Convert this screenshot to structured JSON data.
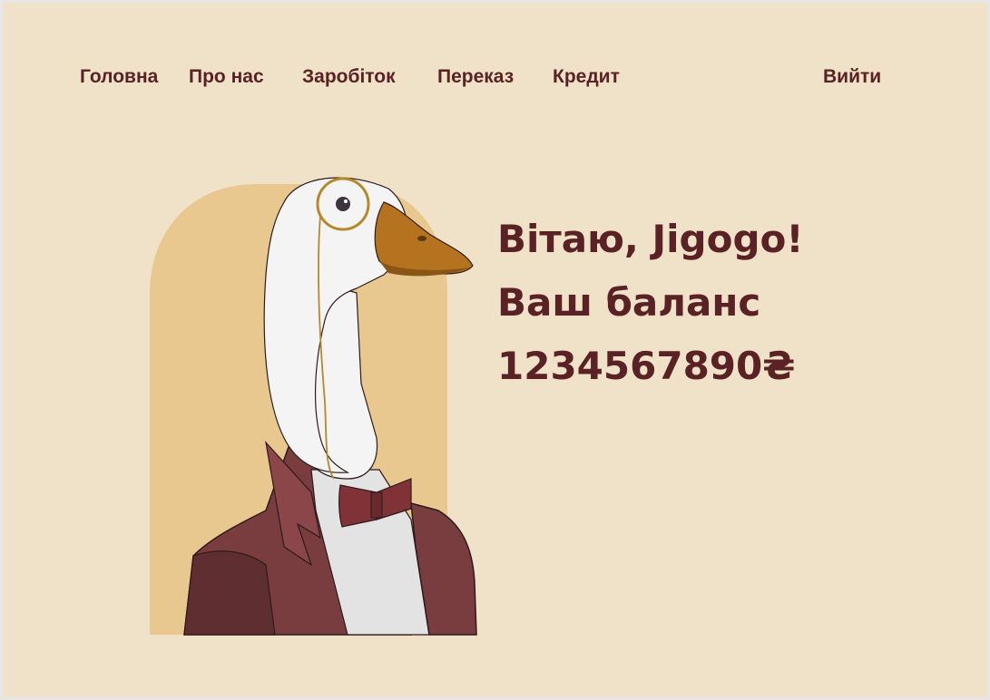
{
  "nav": {
    "items": [
      {
        "label": "Головна"
      },
      {
        "label": "Про нас"
      },
      {
        "label": "Заробіток"
      },
      {
        "label": "Переказ"
      },
      {
        "label": "Кредит"
      }
    ],
    "logout_label": "Вийти"
  },
  "hero": {
    "greeting": "Вітаю, Jigogo!",
    "balance_label": "Ваш баланс",
    "balance_value": "1234567890₴"
  },
  "colors": {
    "page_background": "#efe2c8",
    "text": "#5a2224",
    "arch": "#e8c88e",
    "suit": "#7a3d3f",
    "beak": "#b5731f"
  },
  "illustration": {
    "icon": "goose-in-suit-illustration"
  }
}
